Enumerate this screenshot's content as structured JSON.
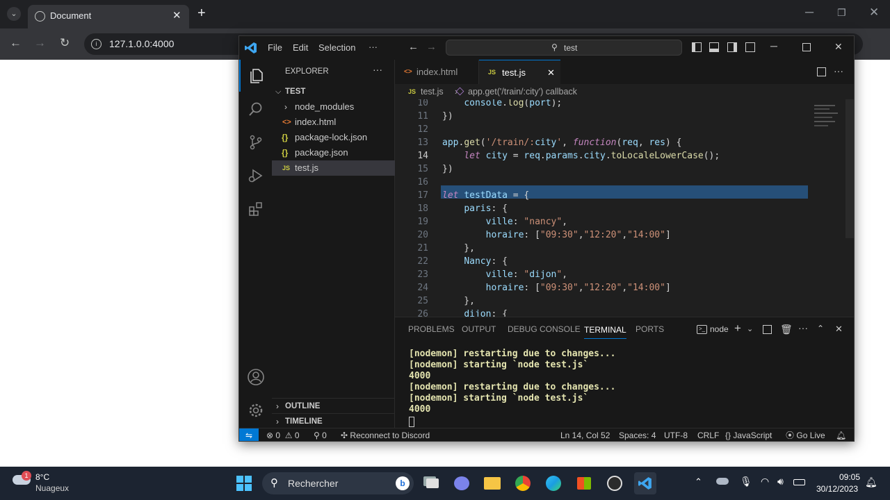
{
  "browser": {
    "tab_title": "Document",
    "url": "127.1.0.0:4000"
  },
  "vscode": {
    "menu": [
      "File",
      "Edit",
      "Selection",
      "···"
    ],
    "search": "test",
    "explorer": {
      "title": "EXPLORER",
      "folder": "TEST",
      "items": [
        {
          "name": "node_modules",
          "icon": "chevron-right-icon"
        },
        {
          "name": "index.html",
          "icon": "html-file-icon"
        },
        {
          "name": "package-lock.json",
          "icon": "json-file-icon"
        },
        {
          "name": "package.json",
          "icon": "json-file-icon"
        },
        {
          "name": "test.js",
          "icon": "js-file-icon"
        }
      ],
      "outline": "OUTLINE",
      "timeline": "TIMELINE"
    },
    "tabs": [
      {
        "label": "index.html"
      },
      {
        "label": "test.js"
      }
    ],
    "breadcrumb": {
      "file": "test.js",
      "symbol": "app.get('/train/:city') callback"
    },
    "code": [
      {
        "n": "10",
        "text": "    console.log(port);"
      },
      {
        "n": "11",
        "text": "})"
      },
      {
        "n": "12",
        "text": ""
      },
      {
        "n": "13",
        "text": "app.get('/train/:city', function(req, res) {"
      },
      {
        "n": "14",
        "text": "    let city = req.params.city.toLocaleLowerCase();"
      },
      {
        "n": "15",
        "text": "})"
      },
      {
        "n": "16",
        "text": ""
      },
      {
        "n": "17",
        "text": "let testData = {"
      },
      {
        "n": "18",
        "text": "    paris: {"
      },
      {
        "n": "19",
        "text": "        ville: \"nancy\","
      },
      {
        "n": "20",
        "text": "        horaire: [\"09:30\",\"12:20\",\"14:00\"]"
      },
      {
        "n": "21",
        "text": "    },"
      },
      {
        "n": "22",
        "text": "    Nancy: {"
      },
      {
        "n": "23",
        "text": "        ville: \"dijon\","
      },
      {
        "n": "24",
        "text": "        horaire: [\"09:30\",\"12:20\",\"14:00\"]"
      },
      {
        "n": "25",
        "text": "    },"
      },
      {
        "n": "26",
        "text": "    dijon: {"
      }
    ],
    "panel": {
      "tabs": [
        "PROBLEMS",
        "OUTPUT",
        "DEBUG CONSOLE",
        "TERMINAL",
        "PORTS"
      ],
      "active_tab": "TERMINAL",
      "terminal_name": "node",
      "lines": [
        "[nodemon] restarting due to changes...",
        "[nodemon] starting `node test.js`",
        "4000",
        "[nodemon] restarting due to changes...",
        "[nodemon] starting `node test.js`",
        "4000"
      ]
    },
    "status": {
      "errors": "0",
      "warnings": "0",
      "ports": "0",
      "discord": "Reconnect to Discord",
      "position": "Ln 14, Col 52",
      "spaces": "Spaces: 4",
      "encoding": "UTF-8",
      "eol": "CRLF",
      "language": "JavaScript",
      "golive": "Go Live"
    }
  },
  "taskbar": {
    "weather_temp": "8°C",
    "weather_desc": "Nuageux",
    "weather_badge": "1",
    "search_placeholder": "Rechercher",
    "time": "09:05",
    "date": "30/12/2023"
  },
  "colors": {
    "accent": "#0078d4",
    "keyword": "#c586c0",
    "function": "#dcdcaa",
    "string": "#ce9178",
    "variable": "#9cdcfe"
  }
}
